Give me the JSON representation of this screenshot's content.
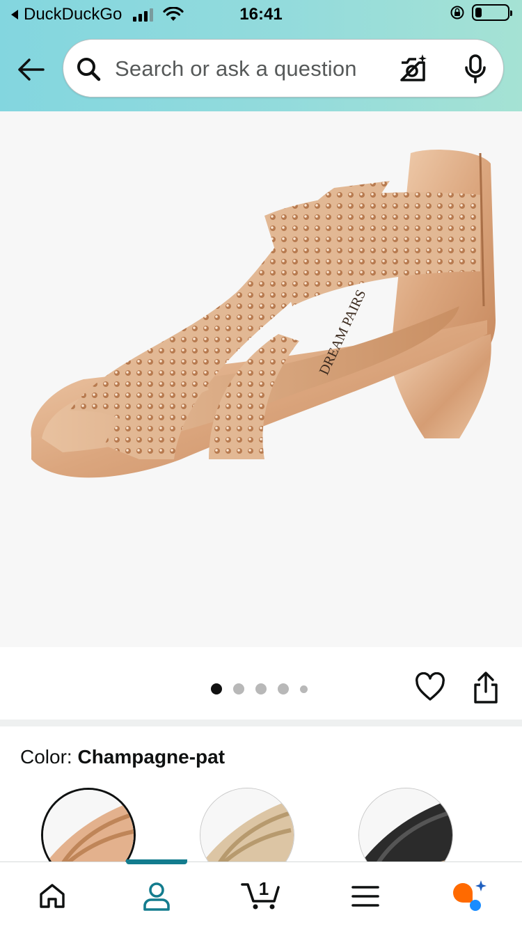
{
  "status_bar": {
    "back_app": "DuckDuckGo",
    "time": "16:41",
    "battery_level": 0.2
  },
  "search": {
    "placeholder": "Search or ask a question"
  },
  "gallery": {
    "image_count": 5,
    "current_image": 1,
    "brand_on_insole": "DREAM PAIRS"
  },
  "product": {
    "color_label": "Color:",
    "color_value": "Champagne-pat",
    "swatches": [
      {
        "name": "Champagne-pat",
        "color": "#e0b28c",
        "selected": true
      },
      {
        "name": "Gold",
        "color": "#dcc3a0",
        "selected": false
      },
      {
        "name": "Black",
        "color": "#2a2a2a",
        "selected": false
      }
    ]
  },
  "bottom_nav": {
    "items": [
      "Home",
      "You",
      "Cart",
      "Menu",
      "Rufus"
    ],
    "active": "You",
    "cart_count": "1",
    "accent_color": "#137c8e"
  }
}
